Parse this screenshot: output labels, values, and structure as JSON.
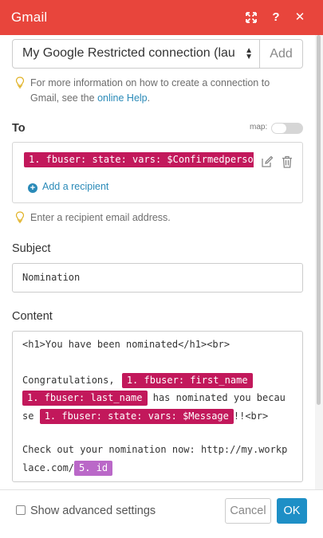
{
  "header": {
    "title": "Gmail"
  },
  "connection": {
    "selected": "My Google Restricted connection (lau",
    "add_label": "Add"
  },
  "connection_hint": {
    "prefix": "For more information on how to create a connection to Gmail, see the ",
    "link": "online Help",
    "suffix": "."
  },
  "to": {
    "label": "To",
    "map_label": "map:",
    "recipient_pill": "1. fbuser: state: vars: $Confirmedperso",
    "add_recipient_label": "Add a recipient",
    "hint": "Enter a recipient email address."
  },
  "subject": {
    "label": "Subject",
    "value": "Nomination"
  },
  "content": {
    "label": "Content",
    "line1": "<h1>You have been nominated</h1><br>",
    "line3_text": "Congratulations, ",
    "pill_first_name": "1. fbuser: first_name",
    "pill_last_name": "1. fbuser: last_name",
    "line4_text": " has nominated you becau",
    "line5_prefix": "se ",
    "pill_message": "1. fbuser: state: vars: $Message",
    "line5_suffix": "!!<br>",
    "line7": "Check out your nomination now: http://my.workp",
    "line8_text": "lace.com/",
    "pill_id": "5. id"
  },
  "footer": {
    "advanced_label": "Show advanced settings",
    "cancel_label": "Cancel",
    "ok_label": "OK"
  },
  "colors": {
    "header": "#e8453c",
    "pill": "#c2185b",
    "pill_purple": "#ba68c8",
    "link": "#2a8ab8",
    "ok": "#1e8fc6"
  }
}
